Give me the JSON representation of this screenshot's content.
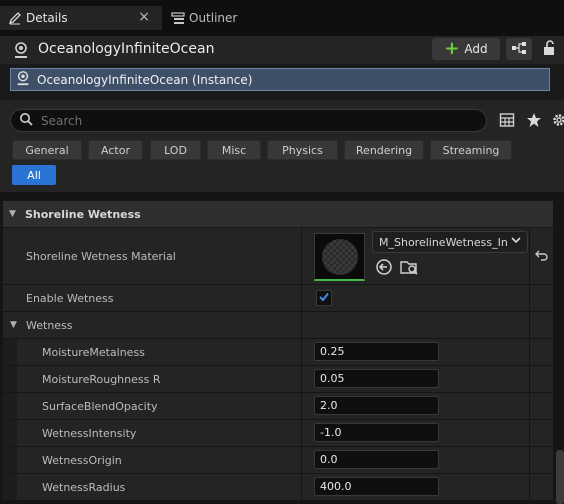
{
  "tabs": {
    "details": "Details",
    "details_close": "×",
    "outliner": "Outliner"
  },
  "header": {
    "actor_name": "OceanologyInfiniteOcean",
    "add_label": "Add"
  },
  "instance": {
    "label": "OceanologyInfiniteOcean (Instance)"
  },
  "search": {
    "placeholder": "Search"
  },
  "filters": [
    "General",
    "Actor",
    "LOD",
    "Misc",
    "Physics",
    "Rendering",
    "Streaming",
    "All"
  ],
  "active_filter": "All",
  "category": {
    "title": "Shoreline Wetness",
    "arrow": "▼"
  },
  "properties": {
    "material_label": "Shoreline Wetness Material",
    "material_value": "M_ShorelineWetness_In",
    "enable_wetness_label": "Enable Wetness",
    "enable_wetness_checked": true
  },
  "subcategory": {
    "title": "Wetness",
    "arrow": "▼"
  },
  "wetness_params": [
    {
      "label": "MoistureMetalness",
      "value": "0.25"
    },
    {
      "label": "MoistureRoughness R",
      "value": "0.05"
    },
    {
      "label": "SurfaceBlendOpacity",
      "value": "2.0"
    },
    {
      "label": "WetnessIntensity",
      "value": "-1.0"
    },
    {
      "label": "WetnessOrigin",
      "value": "0.0"
    },
    {
      "label": "WetnessRadius",
      "value": "400.0"
    }
  ],
  "colors": {
    "accent": "#2a74d6",
    "selection": "#3e5068",
    "add_plus": "#6ccf3a",
    "thumb_underline": "#3fb947"
  }
}
